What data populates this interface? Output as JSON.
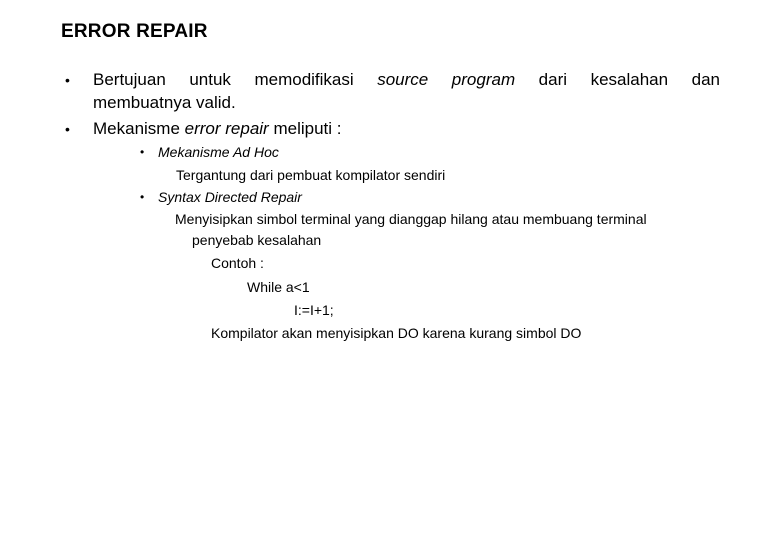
{
  "slide": {
    "title": "ERROR REPAIR",
    "bullets": [
      {
        "bullet": "•",
        "words": [
          "Bertujuan",
          "untuk",
          "memodifikasi",
          "source",
          "program",
          "dari",
          "kesalahan",
          "dan"
        ],
        "continuation": "membuatnya valid."
      },
      {
        "bullet": "•",
        "prefix": "Mekanisme ",
        "italic": "error repair",
        "suffix": " meliputi :"
      }
    ],
    "sub_bullets": [
      {
        "bullet": "•",
        "label": "Mekanisme Ad Hoc",
        "description": "Tergantung dari pembuat kompilator sendiri"
      },
      {
        "bullet": "•",
        "label": "Syntax Directed Repair",
        "description_line1": "Menyisipkan simbol terminal yang dianggap hilang atau membuang terminal",
        "description_line2": "penyebab kesalahan"
      }
    ],
    "example": {
      "label": "Contoh :",
      "code_line1": "While a<1",
      "code_line2": "I:=I+1;",
      "explanation": "Kompilator akan menyisipkan DO karena kurang simbol DO"
    }
  }
}
